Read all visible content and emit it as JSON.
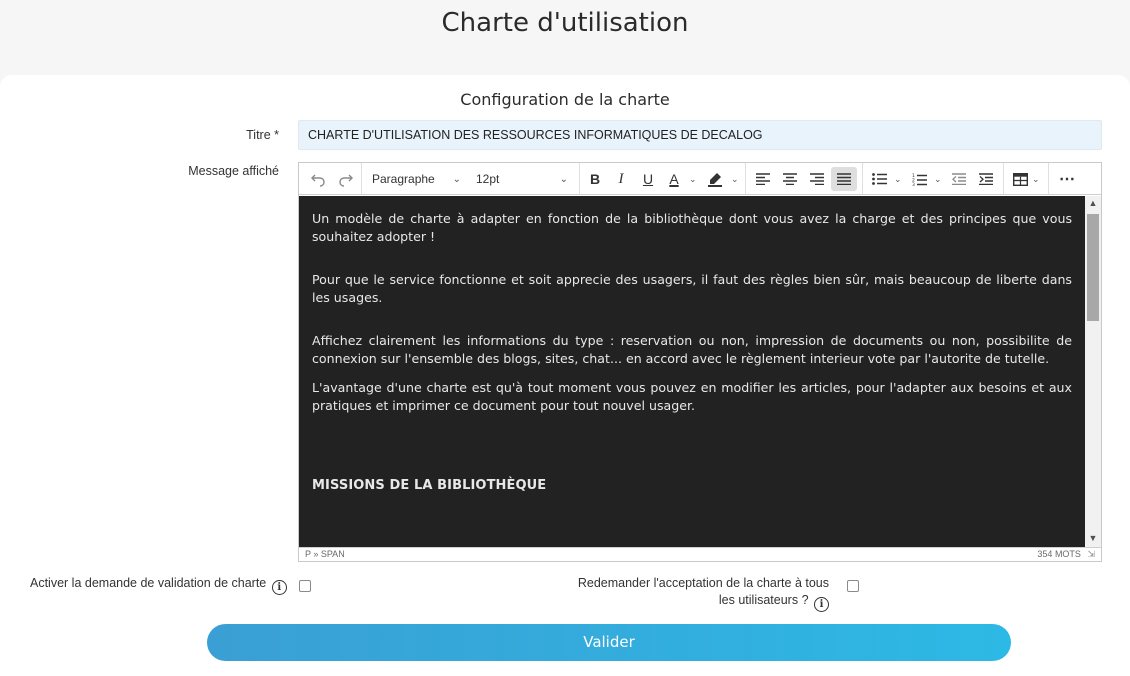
{
  "page": {
    "title": "Charte d'utilisation"
  },
  "section": {
    "title": "Configuration de la charte"
  },
  "form": {
    "title_label": "Titre *",
    "title_value": "CHARTE D'UTILISATION DES RESSOURCES INFORMATIQUES DE DECALOG",
    "message_label": "Message affiché"
  },
  "toolbar": {
    "block_format": "Paragraphe",
    "font_size": "12pt",
    "bold": "B",
    "italic": "I",
    "underline": "U",
    "text_color": "A"
  },
  "editor": {
    "paragraphs": [
      "Un modèle de charte à adapter en fonction de la bibliothèque dont vous avez la charge et des principes que vous souhaitez adopter !",
      "Pour que le service fonctionne et soit apprecie des usagers, il faut des règles bien sûr, mais beaucoup de liberte dans les usages.",
      "Affichez clairement les informations du type : reservation ou non, impression de documents ou non, possibilite de connexion sur l'ensemble des blogs, sites, chat... en accord avec le règlement interieur vote par l'autorite de tutelle.",
      "L'avantage d'une charte est qu'à tout moment vous pouvez en modifier les articles, pour l'adapter aux besoins et aux pratiques et imprimer ce document pour tout nouvel  usager."
    ],
    "heading": "MISSIONS DE LA BIBLIOTHÈQUE",
    "path": "P » SPAN",
    "word_count": "354 MOTS"
  },
  "options": {
    "enable_validation_label": "Activer la demande de validation de charte",
    "reask_label_line1": "Redemander l'acceptation de la charte à tous",
    "reask_label_line2": "les utilisateurs ?"
  },
  "actions": {
    "submit_label": "Valider"
  }
}
